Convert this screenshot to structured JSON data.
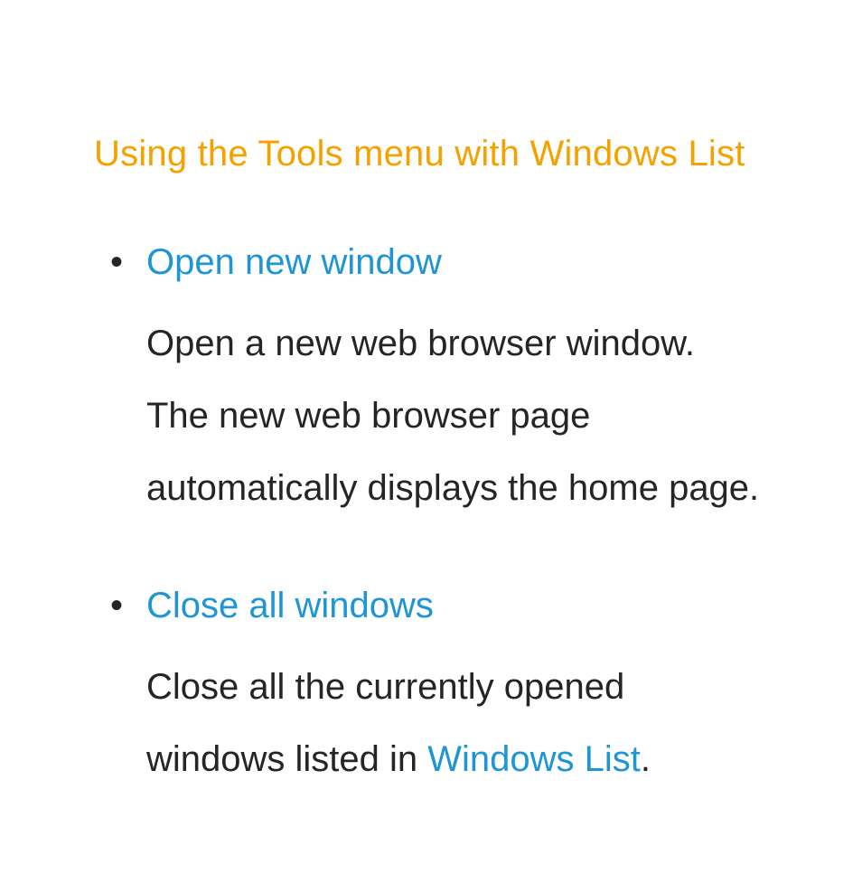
{
  "heading": "Using the Tools menu with Windows List",
  "items": [
    {
      "title": "Open new window",
      "desc_pre": "Open a new web browser window. The new web browser page automatically displays the home page.",
      "link": "",
      "desc_post": ""
    },
    {
      "title": "Close all windows",
      "desc_pre": "Close all the currently opened windows listed in ",
      "link": "Windows List",
      "desc_post": "."
    }
  ]
}
